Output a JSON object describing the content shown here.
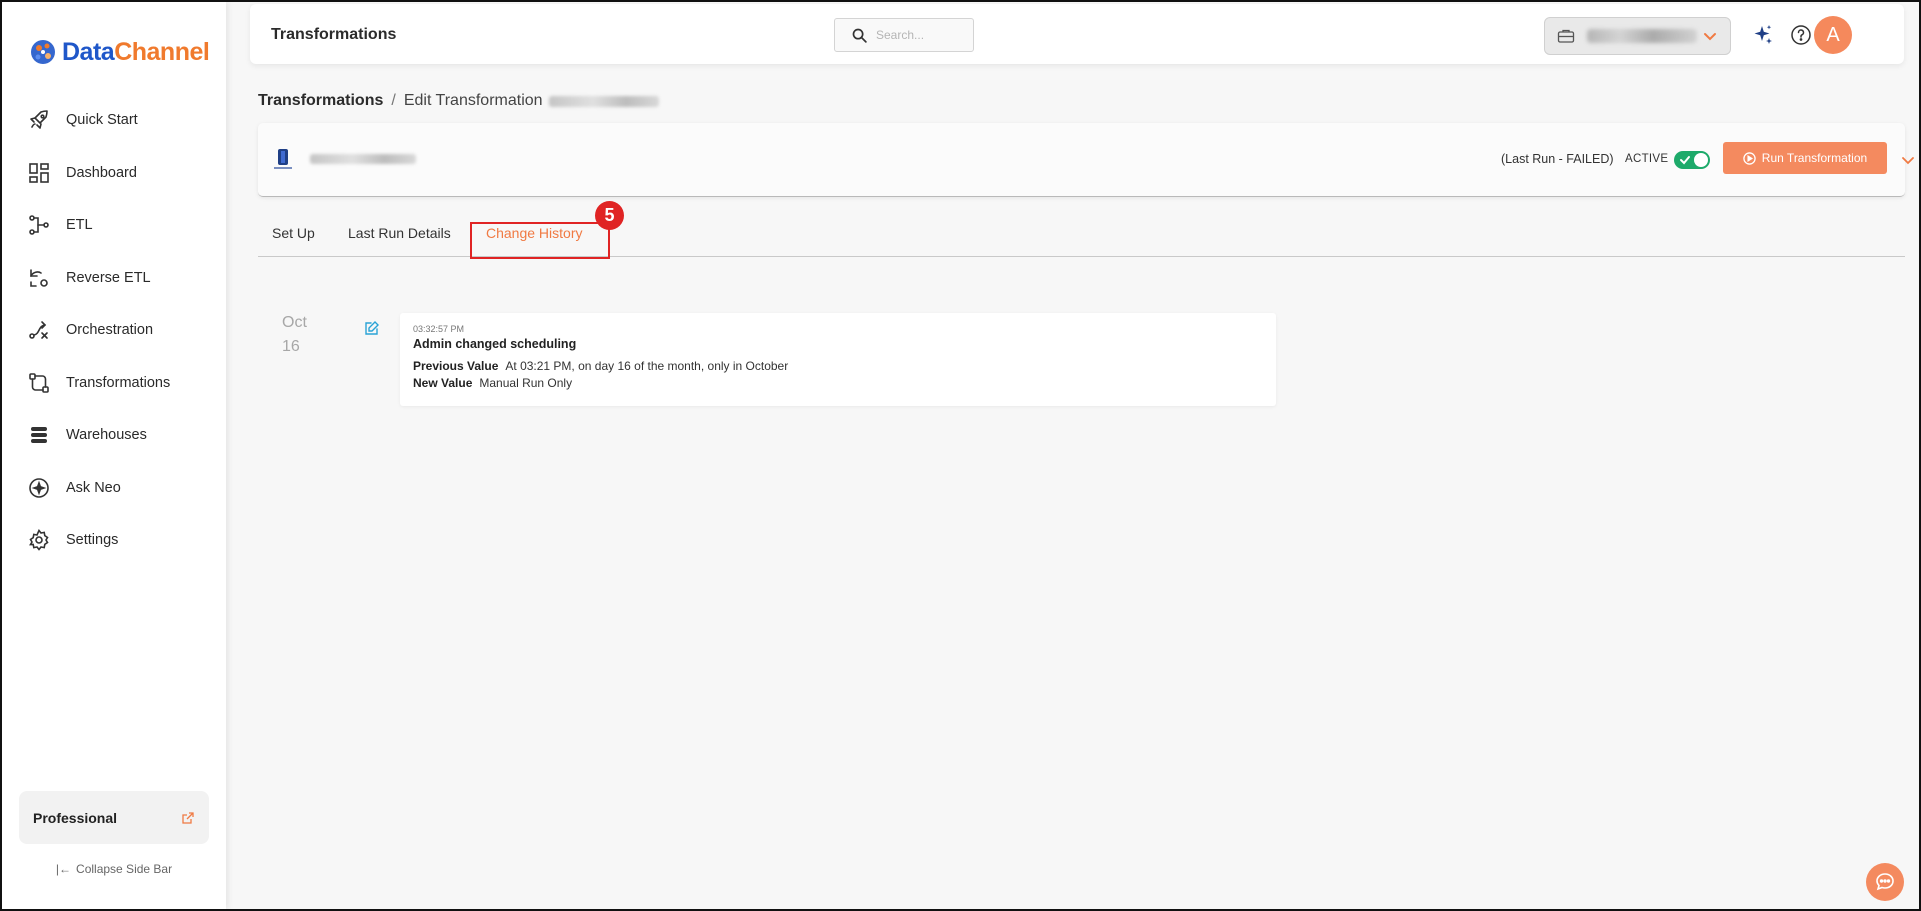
{
  "brand": {
    "name_part1": "Data",
    "name_part2": "Channel"
  },
  "sidebar": {
    "items": [
      {
        "label": "Quick Start",
        "icon": "rocket-icon"
      },
      {
        "label": "Dashboard",
        "icon": "dashboard-icon"
      },
      {
        "label": "ETL",
        "icon": "etl-icon"
      },
      {
        "label": "Reverse ETL",
        "icon": "reverse-etl-icon"
      },
      {
        "label": "Orchestration",
        "icon": "orchestration-icon"
      },
      {
        "label": "Transformations",
        "icon": "transformations-icon"
      },
      {
        "label": "Warehouses",
        "icon": "warehouses-icon"
      },
      {
        "label": "Ask Neo",
        "icon": "ask-neo-icon"
      },
      {
        "label": "Settings",
        "icon": "gear-icon"
      }
    ],
    "plan": "Professional",
    "collapse_label": "Collapse Side Bar"
  },
  "topbar": {
    "title": "Transformations",
    "search_placeholder": "Search...",
    "avatar_letter": "A"
  },
  "breadcrumb": {
    "root": "Transformations",
    "separator": "/",
    "current": "Edit Transformation"
  },
  "header_card": {
    "last_run_status": "(Last Run - FAILED)",
    "active_label": "ACTIVE",
    "toggle_on": true,
    "run_button_label": "Run Transformation"
  },
  "tabs": [
    {
      "label": "Set Up",
      "active": false
    },
    {
      "label": "Last Run Details",
      "active": false
    },
    {
      "label": "Change History",
      "active": true
    }
  ],
  "annotation": {
    "step_number": "5"
  },
  "history": [
    {
      "month": "Oct",
      "day": "16",
      "time": "03:32:57 PM",
      "title": "Admin changed scheduling",
      "previous_label": "Previous Value",
      "previous_value": "At 03:21 PM, on day 16 of the month, only in October",
      "new_label": "New Value",
      "new_value": "Manual Run Only"
    }
  ],
  "colors": {
    "accent": "#f48a5f",
    "brand_blue": "#1f57c9",
    "brand_orange": "#f07a2d",
    "toggle_green": "#1daa6a",
    "highlight_red": "#e02424"
  }
}
